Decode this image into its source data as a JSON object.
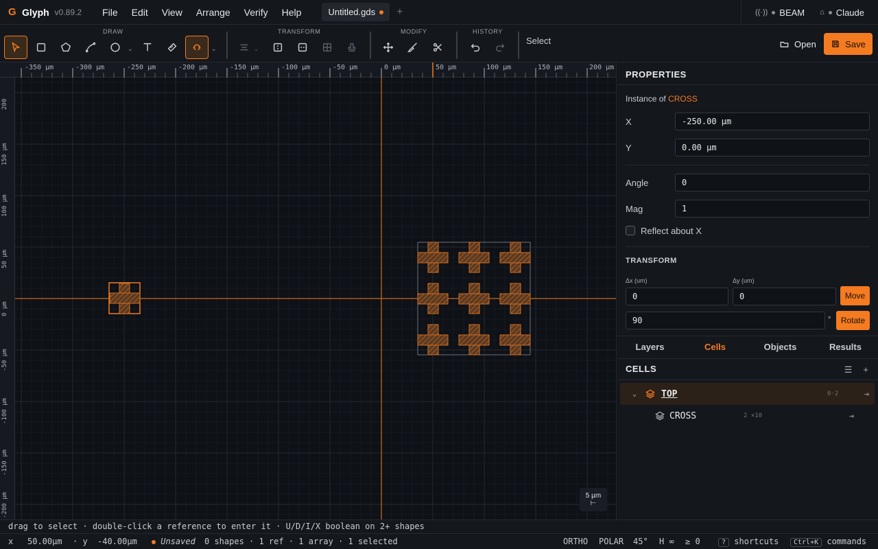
{
  "app": {
    "name": "Glyph",
    "version": "v0.89.2"
  },
  "menu": [
    "File",
    "Edit",
    "View",
    "Arrange",
    "Verify",
    "Help"
  ],
  "file_tab": {
    "name": "Untitled.gds",
    "add_icon": "plus-icon"
  },
  "status_pills": [
    {
      "icon": "broadcast-icon",
      "label": "BEAM"
    },
    {
      "icon": "robot-icon",
      "label": "Claude"
    }
  ],
  "toolbar": {
    "groups": {
      "draw": "DRAW",
      "transform": "TRANSFORM",
      "modify": "MODIFY",
      "history": "HISTORY"
    },
    "current_tool": "Select",
    "open_label": "Open",
    "save_label": "Save"
  },
  "rulers": {
    "top": [
      "-350 µm",
      "-300 µm",
      "-250 µm",
      "-200 µm",
      "-150 µm",
      "-100 µm",
      "-50 µm",
      "0 µm",
      "50 µm",
      "100 µm",
      "150 µm",
      "200 µm"
    ],
    "left": [
      "200",
      "150 µm",
      "100 µm",
      "50 µm",
      "0 µm",
      "-50 µm",
      "-100 µm",
      "-150 µm",
      "-200 µm"
    ]
  },
  "scale": {
    "label": "5 µm"
  },
  "properties": {
    "title": "PROPERTIES",
    "instance_prefix": "Instance of",
    "instance_cell": "CROSS",
    "x_label": "X",
    "x_value": "-250.00 µm",
    "y_label": "Y",
    "y_value": "0.00 µm",
    "angle_label": "Angle",
    "angle_value": "0",
    "mag_label": "Mag",
    "mag_value": "1",
    "reflect_label": "Reflect about X",
    "reflect_checked": false
  },
  "transform": {
    "title": "TRANSFORM",
    "dx_label": "Δx (um)",
    "dx_value": "0",
    "dy_label": "Δy (um)",
    "dy_value": "0",
    "move_label": "Move",
    "angle_value": "90",
    "deg_symbol": "°",
    "rotate_label": "Rotate"
  },
  "panel_tabs": [
    {
      "label": "Layers",
      "active": false
    },
    {
      "label": "Cells",
      "active": true
    },
    {
      "label": "Objects",
      "active": false
    },
    {
      "label": "Results",
      "active": false
    }
  ],
  "cells": {
    "title": "CELLS",
    "items": [
      {
        "name": "TOP",
        "meta": "0·2",
        "active": true
      },
      {
        "name": "CROSS",
        "meta": "2 ×10",
        "active": false
      }
    ]
  },
  "hint": "drag to select · double-click a reference to enter it · U/D/I/X boolean on 2+ shapes",
  "status": {
    "x_label": "x",
    "x_value": "50.00µm",
    "y_label": "· y",
    "y_value": "-40.00µm",
    "save_state": "Unsaved",
    "counts": "0 shapes · 1 ref · 1 array · 1 selected",
    "ortho": "ORTHO",
    "polar": "POLAR",
    "angle": "45°",
    "h": "H ∞",
    "ge": "≥ 0",
    "shortcuts_key": "?",
    "shortcuts_label": "shortcuts",
    "commands_key": "Ctrl+K",
    "commands_label": "commands"
  },
  "colors": {
    "accent": "#f47b20",
    "bg": "#0e1116",
    "panel": "#14171c"
  }
}
